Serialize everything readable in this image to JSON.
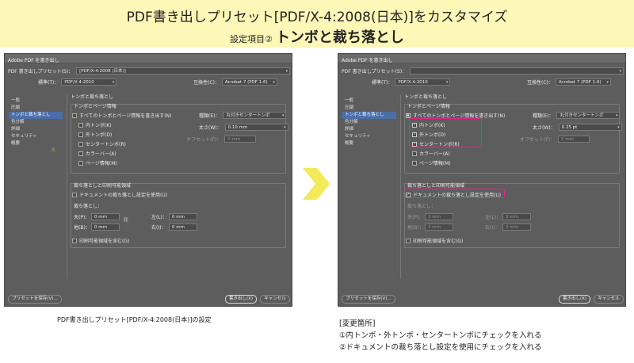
{
  "banner": {
    "title": "PDF書き出しプリセット[PDF/X-4:2008(日本)]をカスタマイズ",
    "subtitle_prefix": "設定項目②",
    "subtitle_main": "トンボと裁ち落とし"
  },
  "dialog": {
    "window_title": "Adobe PDF を書き出し",
    "preset_label": "PDF 書き出しプリセット(S)：",
    "standard_label": "標準(T)：",
    "standard_value": "PDF/X-4:2010",
    "compat_label": "互換性(C)：",
    "compat_value": "Acrobat 7 (PDF 1.6)",
    "sidebar": [
      "一般",
      "圧縮",
      "トンボと裁ち落とし",
      "色分解",
      "詳細",
      "セキュリティ",
      "概要"
    ],
    "section_title": "トンボと裁ち落とし",
    "marks_group": "トンボとページ情報",
    "all_marks": "すべてのトンボとページ情報を書き出す(N)",
    "crop": "内トンボ(K)",
    "trim": "外トンボ(D)",
    "center": "センタートンボ(R)",
    "color_bar": "カラーバー(A)",
    "page_info": "ページ情報(M)",
    "type_label": "種類(E)：",
    "type_value": "丸付きセンタートンボ",
    "weight_label": "太さ(W)：",
    "offset_label": "オフセット(F)：",
    "offset_value": "0 mm",
    "bleed_group": "裁ち落としと印刷可能領域",
    "use_doc_bleed": "ドキュメントの裁ち落とし設定を使用(U)",
    "bleed_label": "裁ち落とし：",
    "top_label": "天(P)：",
    "bottom_label": "地(B)：",
    "left_label": "左(L)：",
    "right_label": "右(I)：",
    "include_slug": "印刷可能領域を含む(G)",
    "save_preset": "プリセットを保存(V)...",
    "export": "書き出し(X)",
    "cancel": "キャンセル"
  },
  "left": {
    "preset_value": "[PDF/X-4:2008 (日本)]",
    "weight_value": "0.10 mm",
    "bleed_value": "0 mm"
  },
  "right": {
    "preset_value": "",
    "weight_value": "0.25 pt",
    "bleed_value": "3 mm"
  },
  "captions": {
    "left": "PDF書き出しプリセット[PDF/X-4:2008(日本)]の設定",
    "right_1": "[変更箇所]",
    "right_2": "①内トンボ・外トンボ・センタートンボにチェックを入れる",
    "right_3": "②ドキュメントの裁ち落とし設定を使用にチェックを入れる"
  },
  "colors": {
    "banner_bg": "#fdf7b8",
    "highlight": "#e0288a",
    "arrow": "#f3ea5a"
  }
}
